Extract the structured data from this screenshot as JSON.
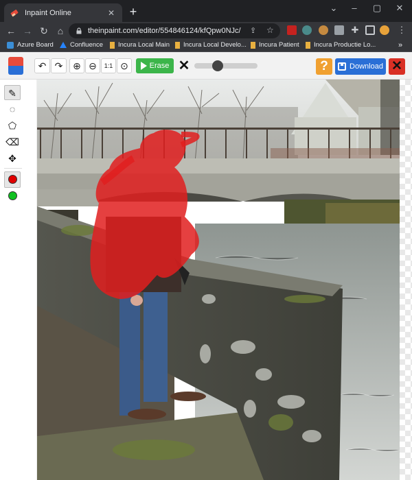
{
  "browser": {
    "tab_title": "Inpaint Online",
    "new_tab": "+",
    "url": "theinpaint.com/editor/554846124/kfQpw0NJc/"
  },
  "bookmarks": [
    {
      "label": "Azure Board",
      "icon_color": "#3b8ed6"
    },
    {
      "label": "Confluence",
      "icon_color": "#2684ff"
    },
    {
      "label": "Incura Local Main",
      "icon_color": "#e8b040"
    },
    {
      "label": "Incura Local Develo...",
      "icon_color": "#e8b040"
    },
    {
      "label": "Incura Patient",
      "icon_color": "#e8b040"
    },
    {
      "label": "Incura Productie Lo...",
      "icon_color": "#e8b040"
    }
  ],
  "toolbar": {
    "erase_label": "Erase",
    "download_label": "Download",
    "help_label": "?",
    "brush_size": 0.34
  },
  "colors": {
    "erase_green": "#3cb54a",
    "download_blue": "#2a6fd6",
    "help_orange": "#f0a030",
    "close_red": "#d93025",
    "mask_red": "#e01e1e",
    "marker_red": "#e00000",
    "marker_green": "#10c020"
  }
}
